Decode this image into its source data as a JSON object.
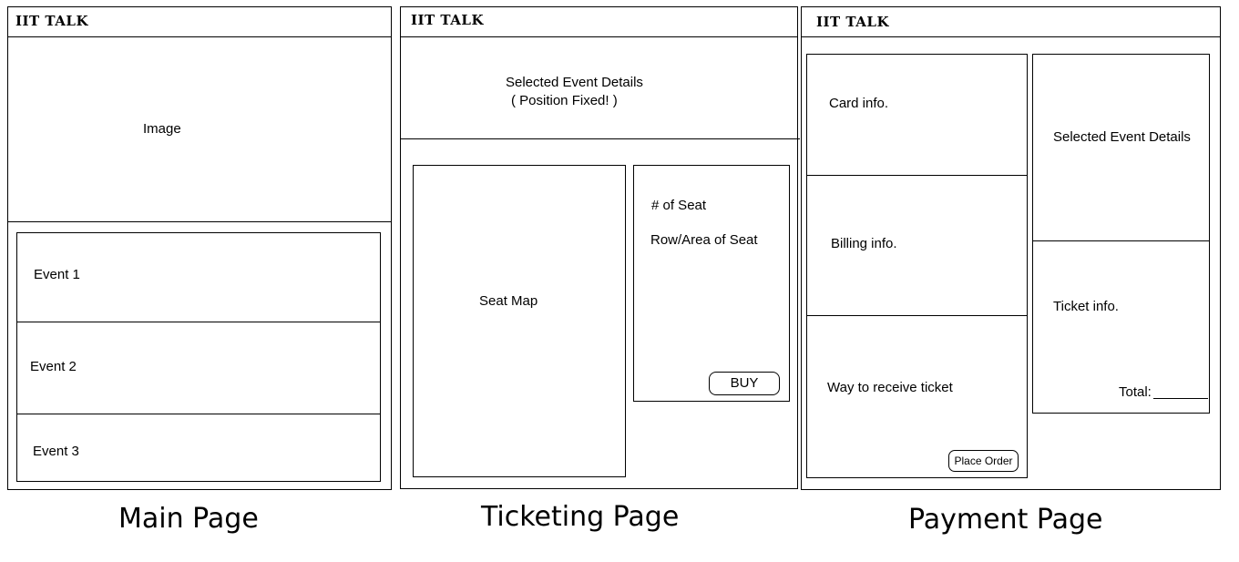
{
  "main_page": {
    "logo": "IIT TALK",
    "image_label": "Image",
    "events": [
      "Event 1",
      "Event 2",
      "Event 3"
    ],
    "caption": "Main Page"
  },
  "ticketing_page": {
    "logo": "IIT TALK",
    "details_title": "Selected Event Details",
    "details_note": "( Position Fixed! )",
    "seat_map_label": "Seat Map",
    "seat_count_label": "# of Seat",
    "seat_area_label": "Row/Area of Seat",
    "buy_label": "BUY",
    "caption": "Ticketing Page"
  },
  "payment_page": {
    "logo": "IIT TALK",
    "card_info": "Card info.",
    "billing_info": "Billing info.",
    "receive_way": "Way to receive ticket",
    "place_order_label": "Place Order",
    "event_details": "Selected Event Details",
    "ticket_info": "Ticket info.",
    "total_label": "Total:",
    "caption": "Payment Page"
  }
}
